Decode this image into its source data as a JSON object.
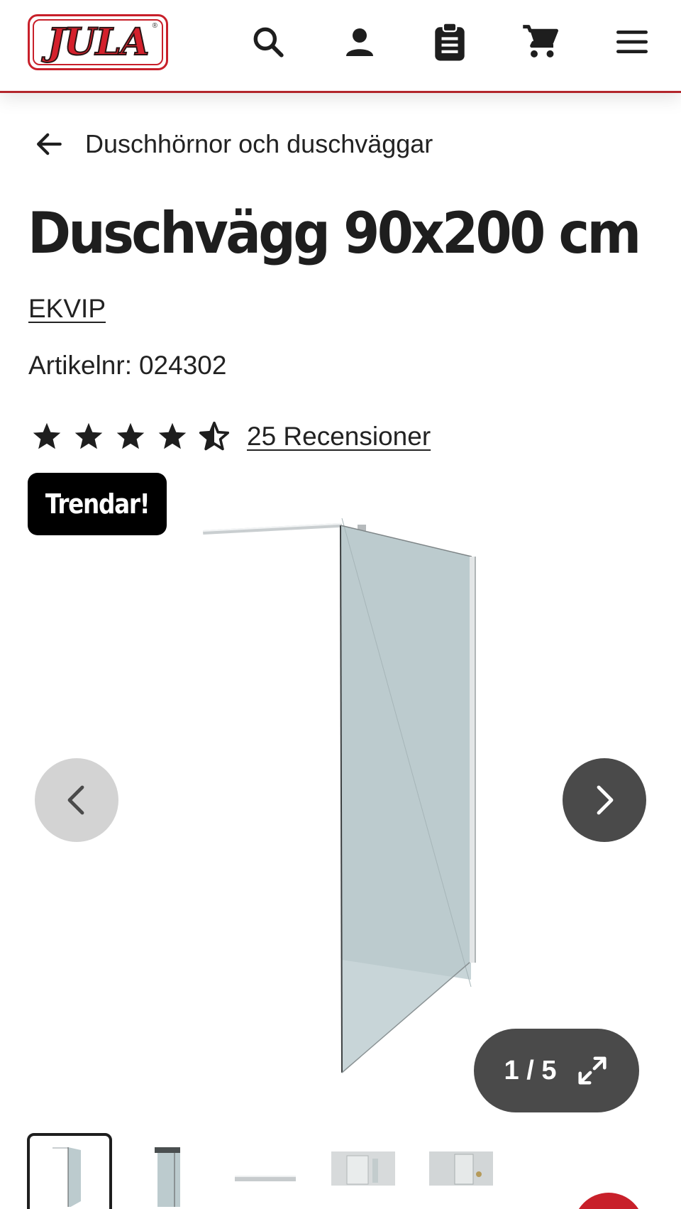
{
  "header": {
    "logo_text": "JULA",
    "icons": [
      "search-icon",
      "account-icon",
      "shopping-list-icon",
      "cart-icon",
      "menu-icon"
    ],
    "accent_color": "#b3262c"
  },
  "breadcrumb": {
    "label": "Duschhörnor och duschväggar"
  },
  "product": {
    "title": "Duschvägg 90x200 cm",
    "brand": "EKVIP",
    "article_label": "Artikelnr:",
    "article_number": "024302",
    "rating": 4.5,
    "reviews_label": "25 Recensioner",
    "badge": "Trendar!"
  },
  "gallery": {
    "counter": "1 / 5",
    "current": 1,
    "total": 5,
    "thumbnails": [
      "Duschvägg",
      "Duschvägg detalj",
      "Väggfäste",
      "Badrum 1",
      "Badrum 2"
    ]
  }
}
